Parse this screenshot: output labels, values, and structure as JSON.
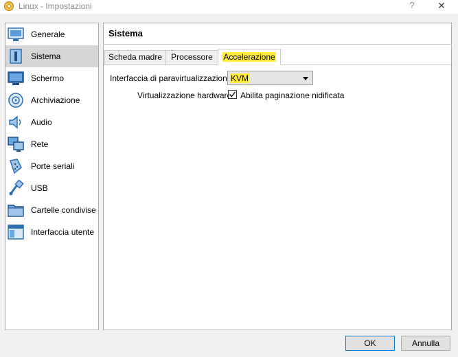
{
  "window": {
    "title": "Linux - Impostazioni",
    "help_glyph": "?",
    "close_glyph": "✕"
  },
  "sidebar": {
    "items": [
      {
        "label": "Generale",
        "icon": "general-icon"
      },
      {
        "label": "Sistema",
        "icon": "system-icon",
        "selected": true
      },
      {
        "label": "Schermo",
        "icon": "display-icon"
      },
      {
        "label": "Archiviazione",
        "icon": "storage-icon"
      },
      {
        "label": "Audio",
        "icon": "audio-icon"
      },
      {
        "label": "Rete",
        "icon": "network-icon"
      },
      {
        "label": "Porte seriali",
        "icon": "serial-ports-icon"
      },
      {
        "label": "USB",
        "icon": "usb-icon"
      },
      {
        "label": "Cartelle condivise",
        "icon": "shared-folders-icon"
      },
      {
        "label": "Interfaccia utente",
        "icon": "user-interface-icon"
      }
    ]
  },
  "main": {
    "title": "Sistema",
    "tabs": [
      {
        "label": "Scheda madre"
      },
      {
        "label": "Processore"
      },
      {
        "label": "Accelerazione",
        "active": true
      }
    ],
    "paravirt": {
      "label": "Interfaccia di paravirtualizzazione:",
      "value": "KVM"
    },
    "hw_virt": {
      "label": "Virtualizzazione hardware:",
      "checkbox_label": "Abilita paginazione nidificata",
      "checked": true
    }
  },
  "buttons": {
    "ok": "OK",
    "cancel": "Annulla"
  },
  "colors": {
    "highlight": "#ffeb3b",
    "selected_bg": "#d6d6d6",
    "default_button_border": "#0078d7"
  }
}
